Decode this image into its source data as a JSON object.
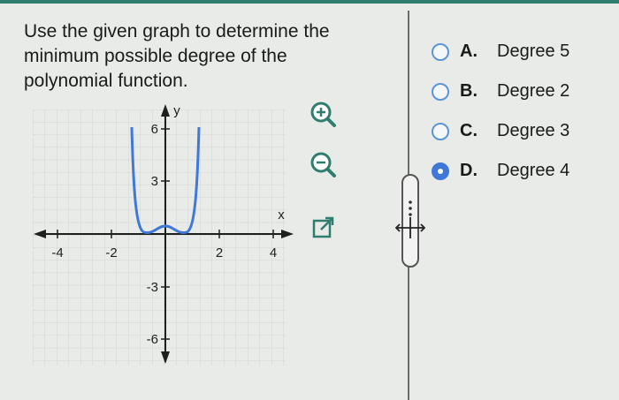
{
  "question": {
    "line1": "Use the given graph to determine the",
    "line2": "minimum possible degree of the",
    "line3": "polynomial function."
  },
  "graph": {
    "x_ticks": [
      "-4",
      "-2",
      "2",
      "4"
    ],
    "y_ticks": [
      "6",
      "3",
      "-3",
      "-6"
    ],
    "x_label": "x",
    "y_label": "y"
  },
  "icons": [
    "zoom-in-icon",
    "zoom-out-icon",
    "popout-icon",
    "resize-handle-icon"
  ],
  "choices": [
    {
      "letter": "A.",
      "label": "Degree 5",
      "selected": false
    },
    {
      "letter": "B.",
      "label": "Degree 2",
      "selected": false
    },
    {
      "letter": "C.",
      "label": "Degree 3",
      "selected": false
    },
    {
      "letter": "D.",
      "label": "Degree 4",
      "selected": true
    }
  ],
  "colors": {
    "accent": "#3f78d6",
    "teal": "#2f7d6e",
    "radio_border": "#5a95d8"
  }
}
